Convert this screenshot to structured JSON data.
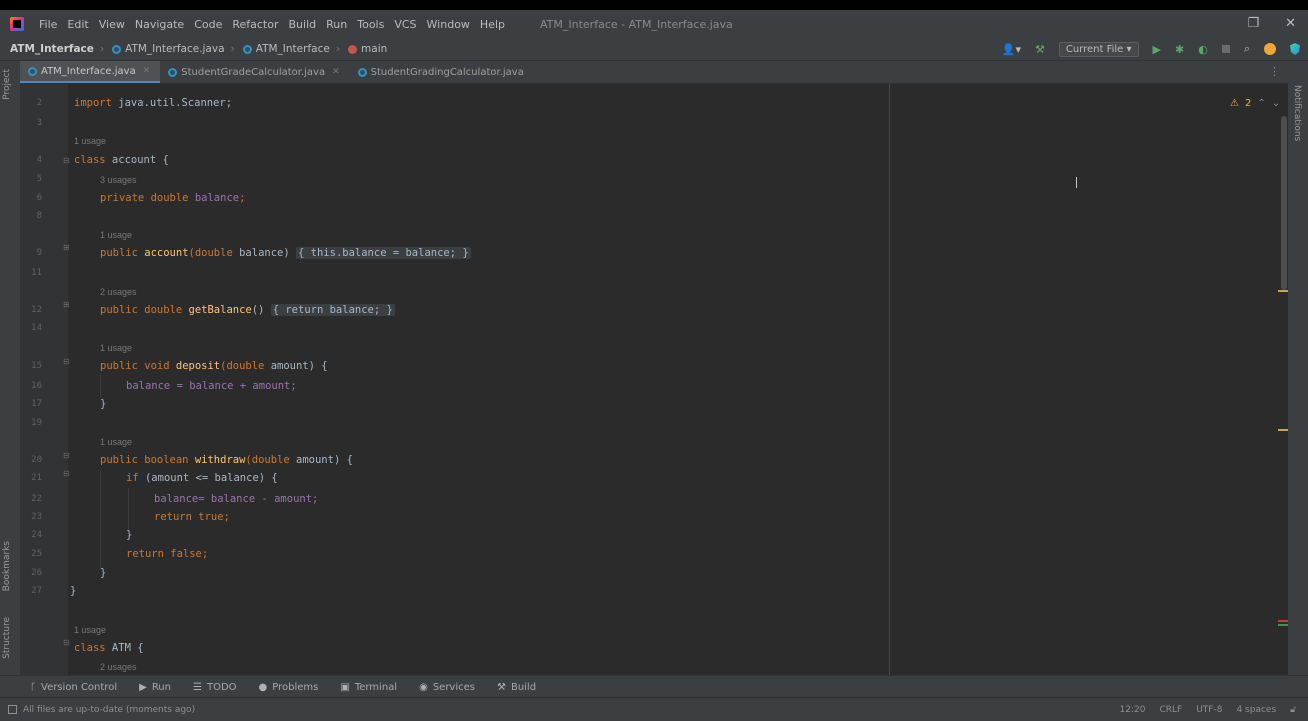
{
  "menubar": {
    "items": [
      "File",
      "Edit",
      "View",
      "Navigate",
      "Code",
      "Refactor",
      "Build",
      "Run",
      "Tools",
      "VCS",
      "Window",
      "Help"
    ],
    "title": "ATM_Interface - ATM_Interface.java"
  },
  "navbar": {
    "project": "ATM_Interface",
    "file": "ATM_Interface.java",
    "class": "ATM_Interface",
    "method": "main",
    "run_config": "Current File"
  },
  "tabs": [
    {
      "label": "ATM_Interface.java",
      "active": true
    },
    {
      "label": "StudentGradeCalculator.java",
      "active": false
    },
    {
      "label": "StudentGradingCalculator.java",
      "active": false
    }
  ],
  "left_strip": {
    "top_label": "Project",
    "bottom_label_1": "Bookmarks",
    "bottom_label_2": "Structure"
  },
  "right_strip": {
    "label": "Notifications"
  },
  "editor": {
    "warnings": "2",
    "lines": [
      {
        "num": "2",
        "y": 0
      },
      {
        "num": "3",
        "y": 1
      },
      {
        "num": "4",
        "y": 2
      },
      {
        "num": "5",
        "y": 3
      },
      {
        "num": "6",
        "y": 4
      },
      {
        "num": "8",
        "y": 5
      },
      {
        "num": "9",
        "y": 6
      },
      {
        "num": "11",
        "y": 7
      },
      {
        "num": "12",
        "y": 8
      },
      {
        "num": "14",
        "y": 9
      },
      {
        "num": "15",
        "y": 10
      },
      {
        "num": "16",
        "y": 11
      },
      {
        "num": "17",
        "y": 12
      },
      {
        "num": "19",
        "y": 13
      },
      {
        "num": "20",
        "y": 14
      },
      {
        "num": "21",
        "y": 15
      },
      {
        "num": "22",
        "y": 16
      },
      {
        "num": "23",
        "y": 17
      },
      {
        "num": "24",
        "y": 18
      },
      {
        "num": "25",
        "y": 19
      },
      {
        "num": "26",
        "y": 20
      },
      {
        "num": "27",
        "y": 21
      }
    ],
    "code": {
      "import_kw": "import",
      "import_rest": " java.util.Scanner;",
      "usages_1": "1 usage",
      "class_kw": "class",
      "class_name": " account {",
      "usages_2": "3 usages",
      "balance_decl_kw": "private double",
      "balance_decl_field": " balance",
      "balance_decl_end": ";",
      "usages_3": "1 usage",
      "ctor_kw": "public",
      "ctor_name": " account",
      "ctor_params_kw": "(double",
      "ctor_params_rest": " balance)",
      "ctor_body": "{ this.balance = balance; }",
      "usages_4": "2 usages",
      "get_kw": "public double",
      "get_name": " getBalance",
      "get_paren": "()",
      "get_body": "{ return balance; }",
      "usages_5": "1 usage",
      "dep_kw": "public void",
      "dep_name": " deposit",
      "dep_params_kw": "(double",
      "dep_params_rest": " amount) {",
      "dep_body": "balance = balance + amount;",
      "close_brace": "}",
      "usages_6": "1 usage",
      "wd_kw": "public boolean",
      "wd_name": " withdraw",
      "wd_params_kw": "(double",
      "wd_params_rest": " amount) {",
      "if_kw": "if",
      "if_rest": " (amount <= balance) {",
      "wd_body1": "balance= balance - amount;",
      "ret_true_kw": "return true",
      "ret_true_end": ";",
      "close_inner": "}",
      "ret_false_kw": "return false",
      "ret_false_end": ";",
      "close_method": "}",
      "close_class": "}",
      "usages_7": "1 usage",
      "class2_kw": "class",
      "class2_name": " ATM {",
      "usages_8": "2 usages"
    }
  },
  "bottom_tools": [
    {
      "icon": "version-control-icon",
      "glyph": "ᚴ",
      "label": "Version Control"
    },
    {
      "icon": "run-icon",
      "glyph": "▶",
      "label": "Run"
    },
    {
      "icon": "todo-icon",
      "glyph": "☰",
      "label": "TODO"
    },
    {
      "icon": "problems-icon",
      "glyph": "●",
      "label": "Problems"
    },
    {
      "icon": "terminal-icon",
      "glyph": "▣",
      "label": "Terminal"
    },
    {
      "icon": "services-icon",
      "glyph": "◉",
      "label": "Services"
    },
    {
      "icon": "build-icon",
      "glyph": "⚒",
      "label": "Build"
    }
  ],
  "status": {
    "message": "All files are up-to-date (moments ago)",
    "position": "12:20",
    "line_sep": "CRLF",
    "encoding": "UTF-8",
    "indent": "4 spaces"
  }
}
